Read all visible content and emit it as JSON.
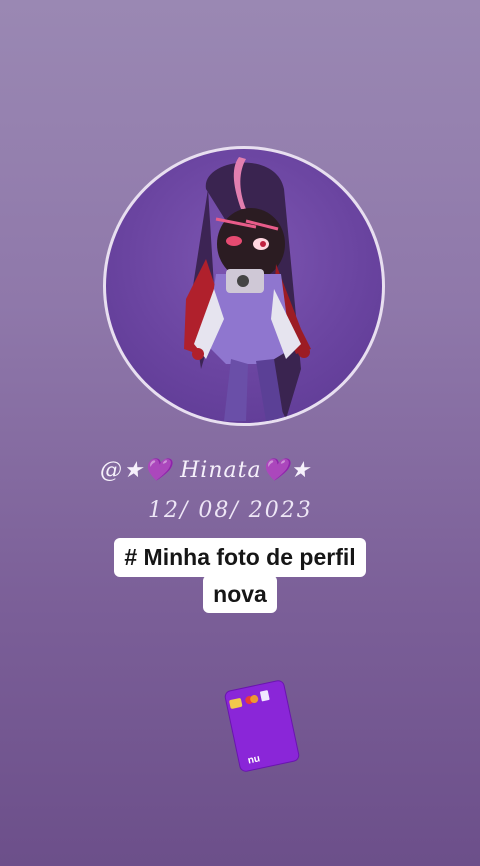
{
  "story": {
    "handle": "@★💜 Hinata💜★",
    "date": "12/ 08/ 2023",
    "caption_line1": "# Minha foto de perfil",
    "caption_line2": "nova",
    "sticker_brand": "nu"
  },
  "colors": {
    "background_top": "#9a88b3",
    "background_bottom": "#6c4f8a",
    "card_purple": "#8a26d8",
    "avatar_purple": "#6a44a0"
  }
}
